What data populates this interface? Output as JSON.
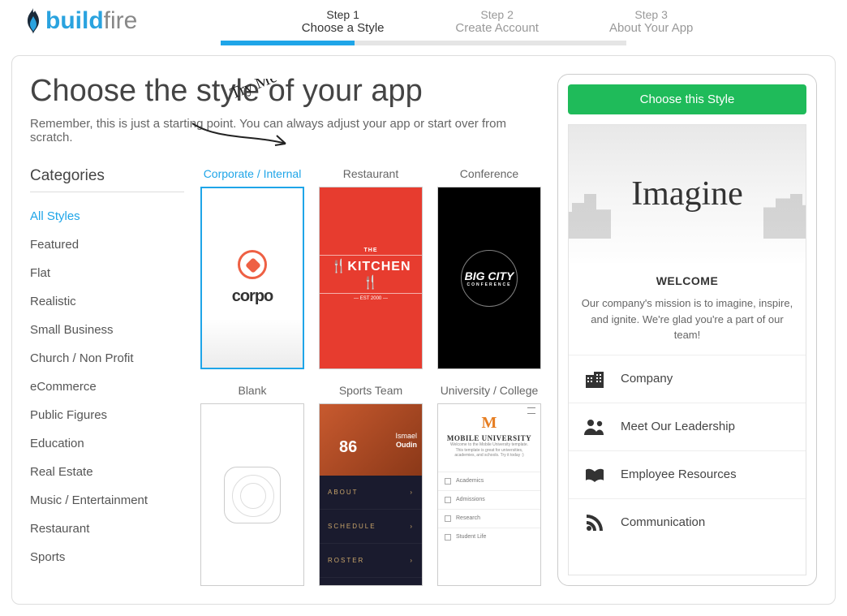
{
  "logo": {
    "part1": "build",
    "part2": "fire"
  },
  "steps": [
    {
      "num": "Step 1",
      "label": "Choose a Style",
      "active": true
    },
    {
      "num": "Step 2",
      "label": "Create Account",
      "active": false
    },
    {
      "num": "Step 3",
      "label": "About Your App",
      "active": false
    }
  ],
  "title": "Choose the style of your app",
  "subtitle": "Remember, this is just a starting point. You can always adjust your app or start over from scratch.",
  "categories_header": "Categories",
  "categories": [
    "All Styles",
    "Featured",
    "Flat",
    "Realistic",
    "Small Business",
    "Church / Non Profit",
    "eCommerce",
    "Public Figures",
    "Education",
    "Real Estate",
    "Music / Entertainment",
    "Restaurant",
    "Sports"
  ],
  "active_category": "All Styles",
  "templates": [
    {
      "name": "Corporate / Internal",
      "kind": "corpo",
      "selected": true,
      "text": "corpo"
    },
    {
      "name": "Restaurant",
      "kind": "kitchen",
      "text": "KITCHEN",
      "sub": "EST 2000",
      "pre": "THE"
    },
    {
      "name": "Conference",
      "kind": "bigcity",
      "text": "BIG CITY",
      "sub": "CONFERENCE"
    },
    {
      "name": "Blank",
      "kind": "blank"
    },
    {
      "name": "Sports Team",
      "kind": "sports",
      "player_first": "Ismael",
      "player_last": "Oudin",
      "jersey": "86",
      "rows": [
        "ABOUT",
        "SCHEDULE",
        "ROSTER"
      ]
    },
    {
      "name": "University / College",
      "kind": "uni",
      "logo": "M",
      "title": "MOBILE UNIVERSITY",
      "desc": "Welcome to the Mobile University template. This template is great for universities, academies, and schools. Try it today :)",
      "items": [
        "Academics",
        "Admissions",
        "Research",
        "Student Life"
      ]
    }
  ],
  "tryme_label": "Try Me",
  "preview": {
    "button": "Choose this Style",
    "hero_title": "Imagine",
    "welcome_header": "WELCOME",
    "welcome_body": "Our company's mission is to imagine, inspire, and ignite. We're glad you're a part of our team!",
    "menu": [
      {
        "icon": "company",
        "label": "Company"
      },
      {
        "icon": "people",
        "label": "Meet Our Leadership"
      },
      {
        "icon": "book",
        "label": "Employee Resources"
      },
      {
        "icon": "rss",
        "label": "Communication"
      }
    ]
  }
}
